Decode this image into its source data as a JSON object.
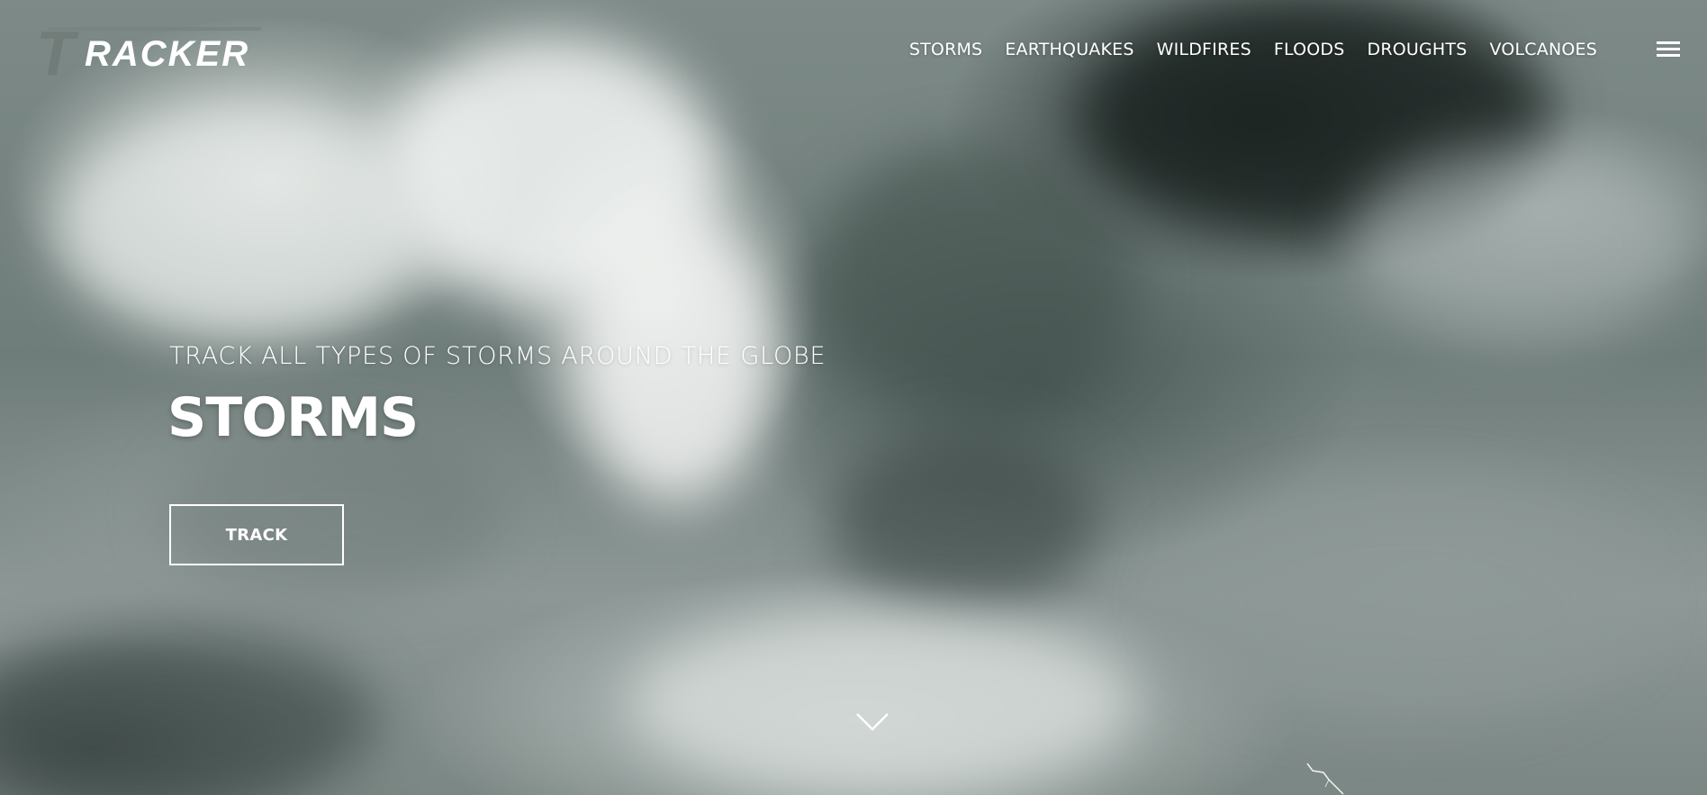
{
  "brand": {
    "logo_text": "RACKER",
    "logo_letter": "T"
  },
  "nav": {
    "items": [
      {
        "label": "STORMS"
      },
      {
        "label": "EARTHQUAKES"
      },
      {
        "label": "WILDFIRES"
      },
      {
        "label": "FLOODS"
      },
      {
        "label": "DROUGHTS"
      },
      {
        "label": "VOLCANOES"
      }
    ],
    "menu_icon": "hamburger-menu-icon"
  },
  "hero": {
    "subtitle": "TRACK ALL TYPES OF STORMS AROUND THE GLOBE",
    "title": "STORMS",
    "button_label": "TRACK",
    "scroll_icon": "chevron-down-icon",
    "background": "stormy-clouds-image"
  },
  "colors": {
    "text": "#ffffff",
    "sky_dark": "#2e3a38",
    "sky_light": "#e6e9e8"
  }
}
